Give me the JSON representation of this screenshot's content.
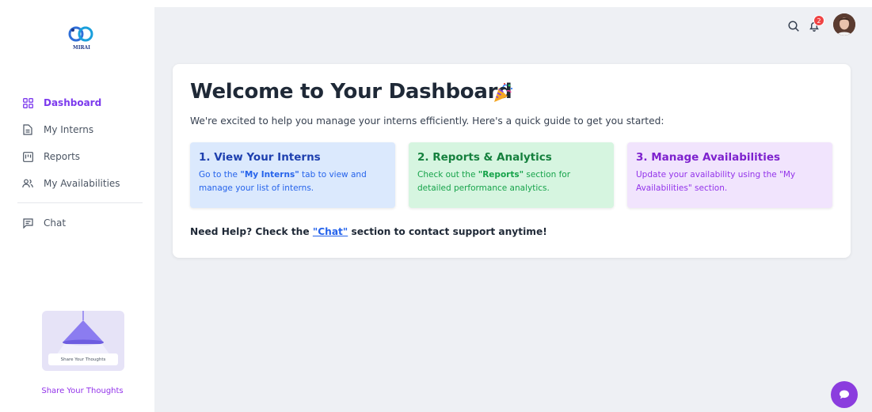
{
  "brand": {
    "logo_text": "MIRAI"
  },
  "sidebar": {
    "items": [
      {
        "label": "Dashboard",
        "icon": "dashboard-grid-icon",
        "active": true
      },
      {
        "label": "My Interns",
        "icon": "document-icon",
        "active": false
      },
      {
        "label": "Reports",
        "icon": "reports-icon",
        "active": false
      },
      {
        "label": "My Availabilities",
        "icon": "users-icon",
        "active": false
      },
      {
        "label": "Chat",
        "icon": "chat-icon",
        "active": false
      }
    ],
    "promo": {
      "button_label": "Share Your Thoughts",
      "link_label": "Share Your Thoughts"
    }
  },
  "header": {
    "notification_count": "2"
  },
  "main": {
    "title": "Welcome to Your Dashboard",
    "intro": "We're excited to help you manage your interns efficiently. Here's a quick guide to get you started:",
    "steps": [
      {
        "title": "1. View Your Interns",
        "pre": "Go to the ",
        "strong": "\"My Interns\"",
        "post": " tab to view and manage your list of interns."
      },
      {
        "title": "2. Reports & Analytics",
        "pre": "Check out the ",
        "strong": "\"Reports\"",
        "post": " section for detailed performance analytics."
      },
      {
        "title": "3. Manage Availabilities",
        "pre": "Update your availability using the \"My Availabilities\" section.",
        "strong": "",
        "post": ""
      }
    ],
    "help": {
      "pre": "Need Help? Check the ",
      "link": "\"Chat\"",
      "post": " section to contact support anytime!"
    }
  },
  "colors": {
    "accent": "#7c3aed",
    "fab": "#8b3dde",
    "badge": "#ef4444"
  }
}
